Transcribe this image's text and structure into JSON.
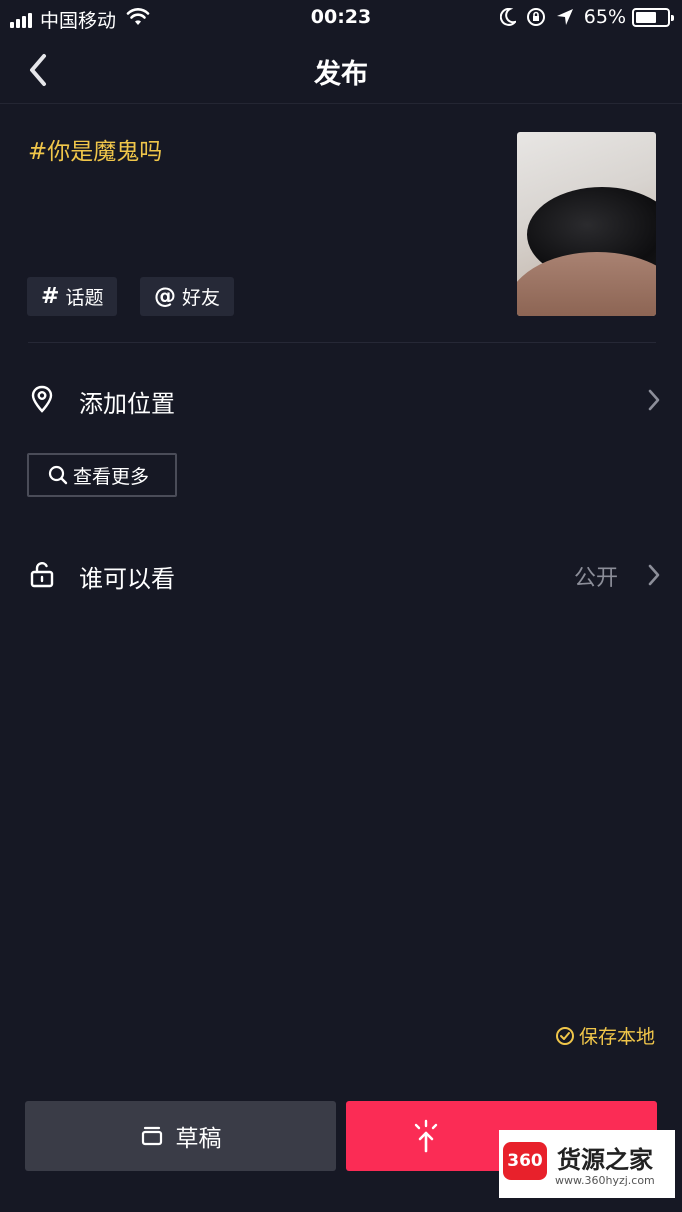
{
  "status_bar": {
    "carrier": "中国移动",
    "time": "00:23",
    "battery": "65%",
    "battery_level": 0.65
  },
  "header": {
    "title": "发布"
  },
  "post": {
    "caption": "#你是魔鬼吗",
    "chips": [
      {
        "symbol": "#",
        "label": "话题",
        "icon": "hashtag-icon"
      },
      {
        "symbol": "@",
        "label": "好友",
        "icon": "at-icon"
      }
    ]
  },
  "location": {
    "label": "添加位置",
    "see_more": "查看更多"
  },
  "visibility": {
    "label": "谁可以看",
    "value": "公开"
  },
  "save_local": {
    "label": "保存本地"
  },
  "footer": {
    "draft_label": "草稿"
  },
  "watermark": {
    "logo_text": "360",
    "name": "货源之家",
    "url": "www.360hyzj.com"
  },
  "colors": {
    "background": "#161824",
    "accent_yellow": "#f0c64a",
    "publish_red": "#fb2c55",
    "chip_bg": "#262937",
    "draft_bg": "#3a3c47"
  }
}
